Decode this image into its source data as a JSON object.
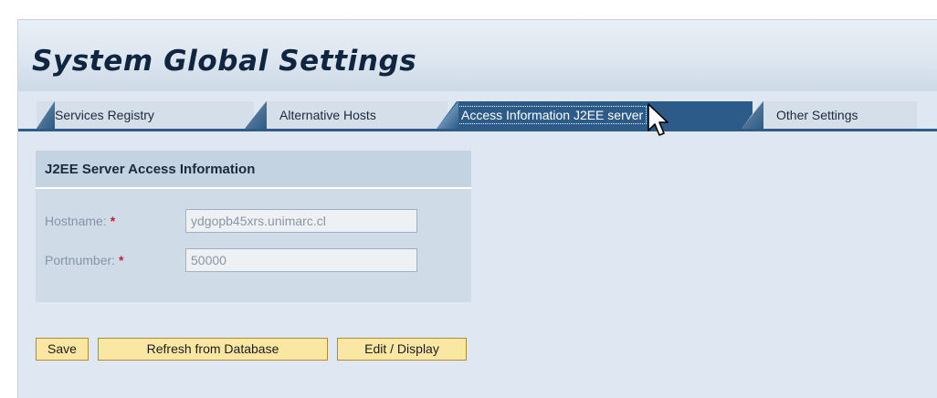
{
  "page": {
    "title": "System Global Settings"
  },
  "tabs": [
    {
      "label": "Services Registry",
      "active": false
    },
    {
      "label": "Alternative Hosts",
      "active": false
    },
    {
      "label": "Access Information J2EE server",
      "active": true
    },
    {
      "label": "Other Settings",
      "active": false
    }
  ],
  "group": {
    "title": "J2EE Server Access Information",
    "fields": [
      {
        "label": "Hostname:",
        "required": "*",
        "value": "ydgopb45xrs.unimarc.cl"
      },
      {
        "label": "Portnumber:",
        "required": "*",
        "value": "50000"
      }
    ]
  },
  "buttons": {
    "save": "Save",
    "refresh": "Refresh from Database",
    "edit_display": "Edit / Display"
  },
  "colors": {
    "active_tab": "#2d5b89",
    "button_bg": "#fbe7a4",
    "required": "#c8203a"
  },
  "icons": {
    "cursor": "arrow-pointer-icon"
  }
}
